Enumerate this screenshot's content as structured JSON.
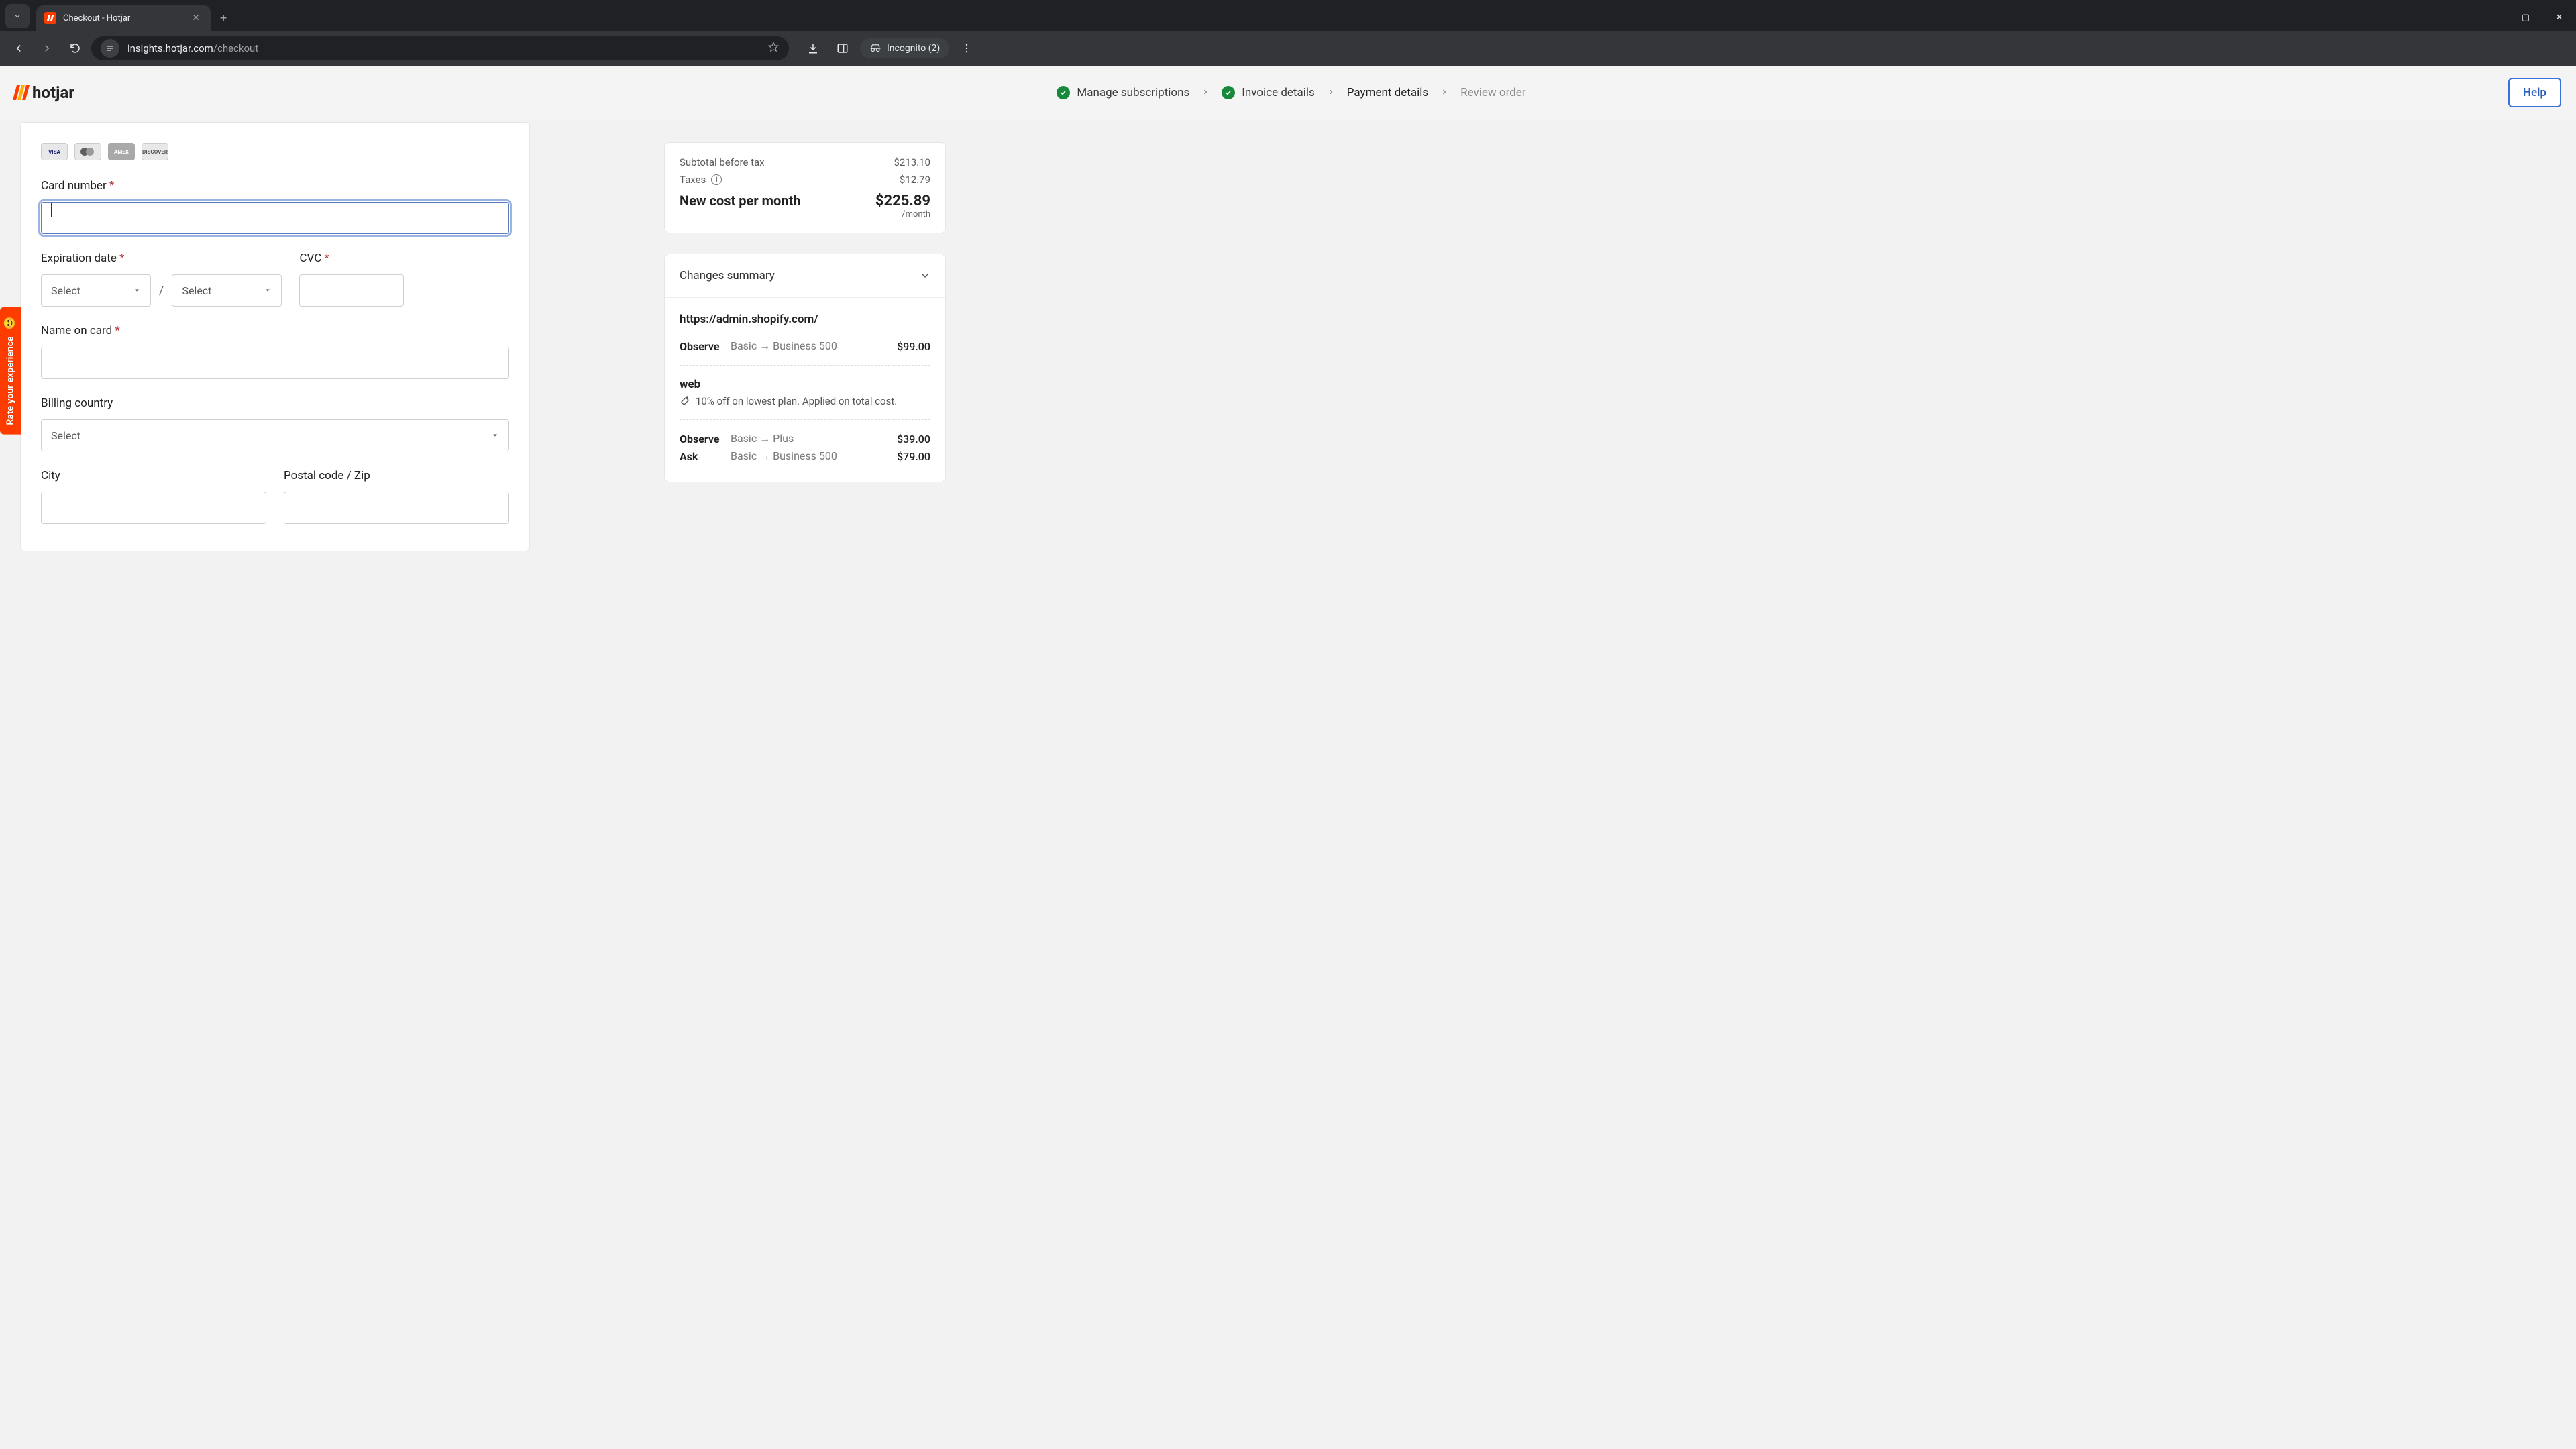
{
  "browser": {
    "tab_title": "Checkout - Hotjar",
    "url_host": "insights.hotjar.com",
    "url_path": "/checkout",
    "incognito": "Incognito (2)"
  },
  "header": {
    "logo_text": "hotjar",
    "steps": {
      "manage": "Manage subscriptions",
      "invoice": "Invoice details",
      "payment": "Payment details",
      "review": "Review order"
    },
    "help": "Help"
  },
  "feedback": {
    "label": "Rate your experience"
  },
  "form": {
    "card_number_label": "Card number",
    "expiration_label": "Expiration date",
    "cvc_label": "CVC",
    "name_label": "Name on card",
    "billing_country_label": "Billing country",
    "city_label": "City",
    "postal_label": "Postal code / Zip",
    "select_placeholder": "Select",
    "card_brands": {
      "visa": "VISA",
      "amex": "AMEX",
      "discover": "DISCOVER"
    }
  },
  "cost": {
    "subtotal_label": "Subtotal before tax",
    "subtotal_value": "$213.10",
    "taxes_label": "Taxes",
    "taxes_value": "$12.79",
    "total_label": "New cost per month",
    "total_value": "$225.89",
    "per": "/month"
  },
  "changes": {
    "title": "Changes summary",
    "site1": {
      "url": "https://admin.shopify.com/",
      "rows": [
        {
          "product": "Observe",
          "delta": "Basic → Business 500",
          "price": "$99.00"
        }
      ]
    },
    "site2": {
      "name": "web",
      "discount": "10% off on lowest plan. Applied on total cost.",
      "rows": [
        {
          "product": "Observe",
          "delta": "Basic → Plus",
          "price": "$39.00"
        },
        {
          "product": "Ask",
          "delta": "Basic → Business 500",
          "price": "$79.00"
        }
      ]
    }
  }
}
